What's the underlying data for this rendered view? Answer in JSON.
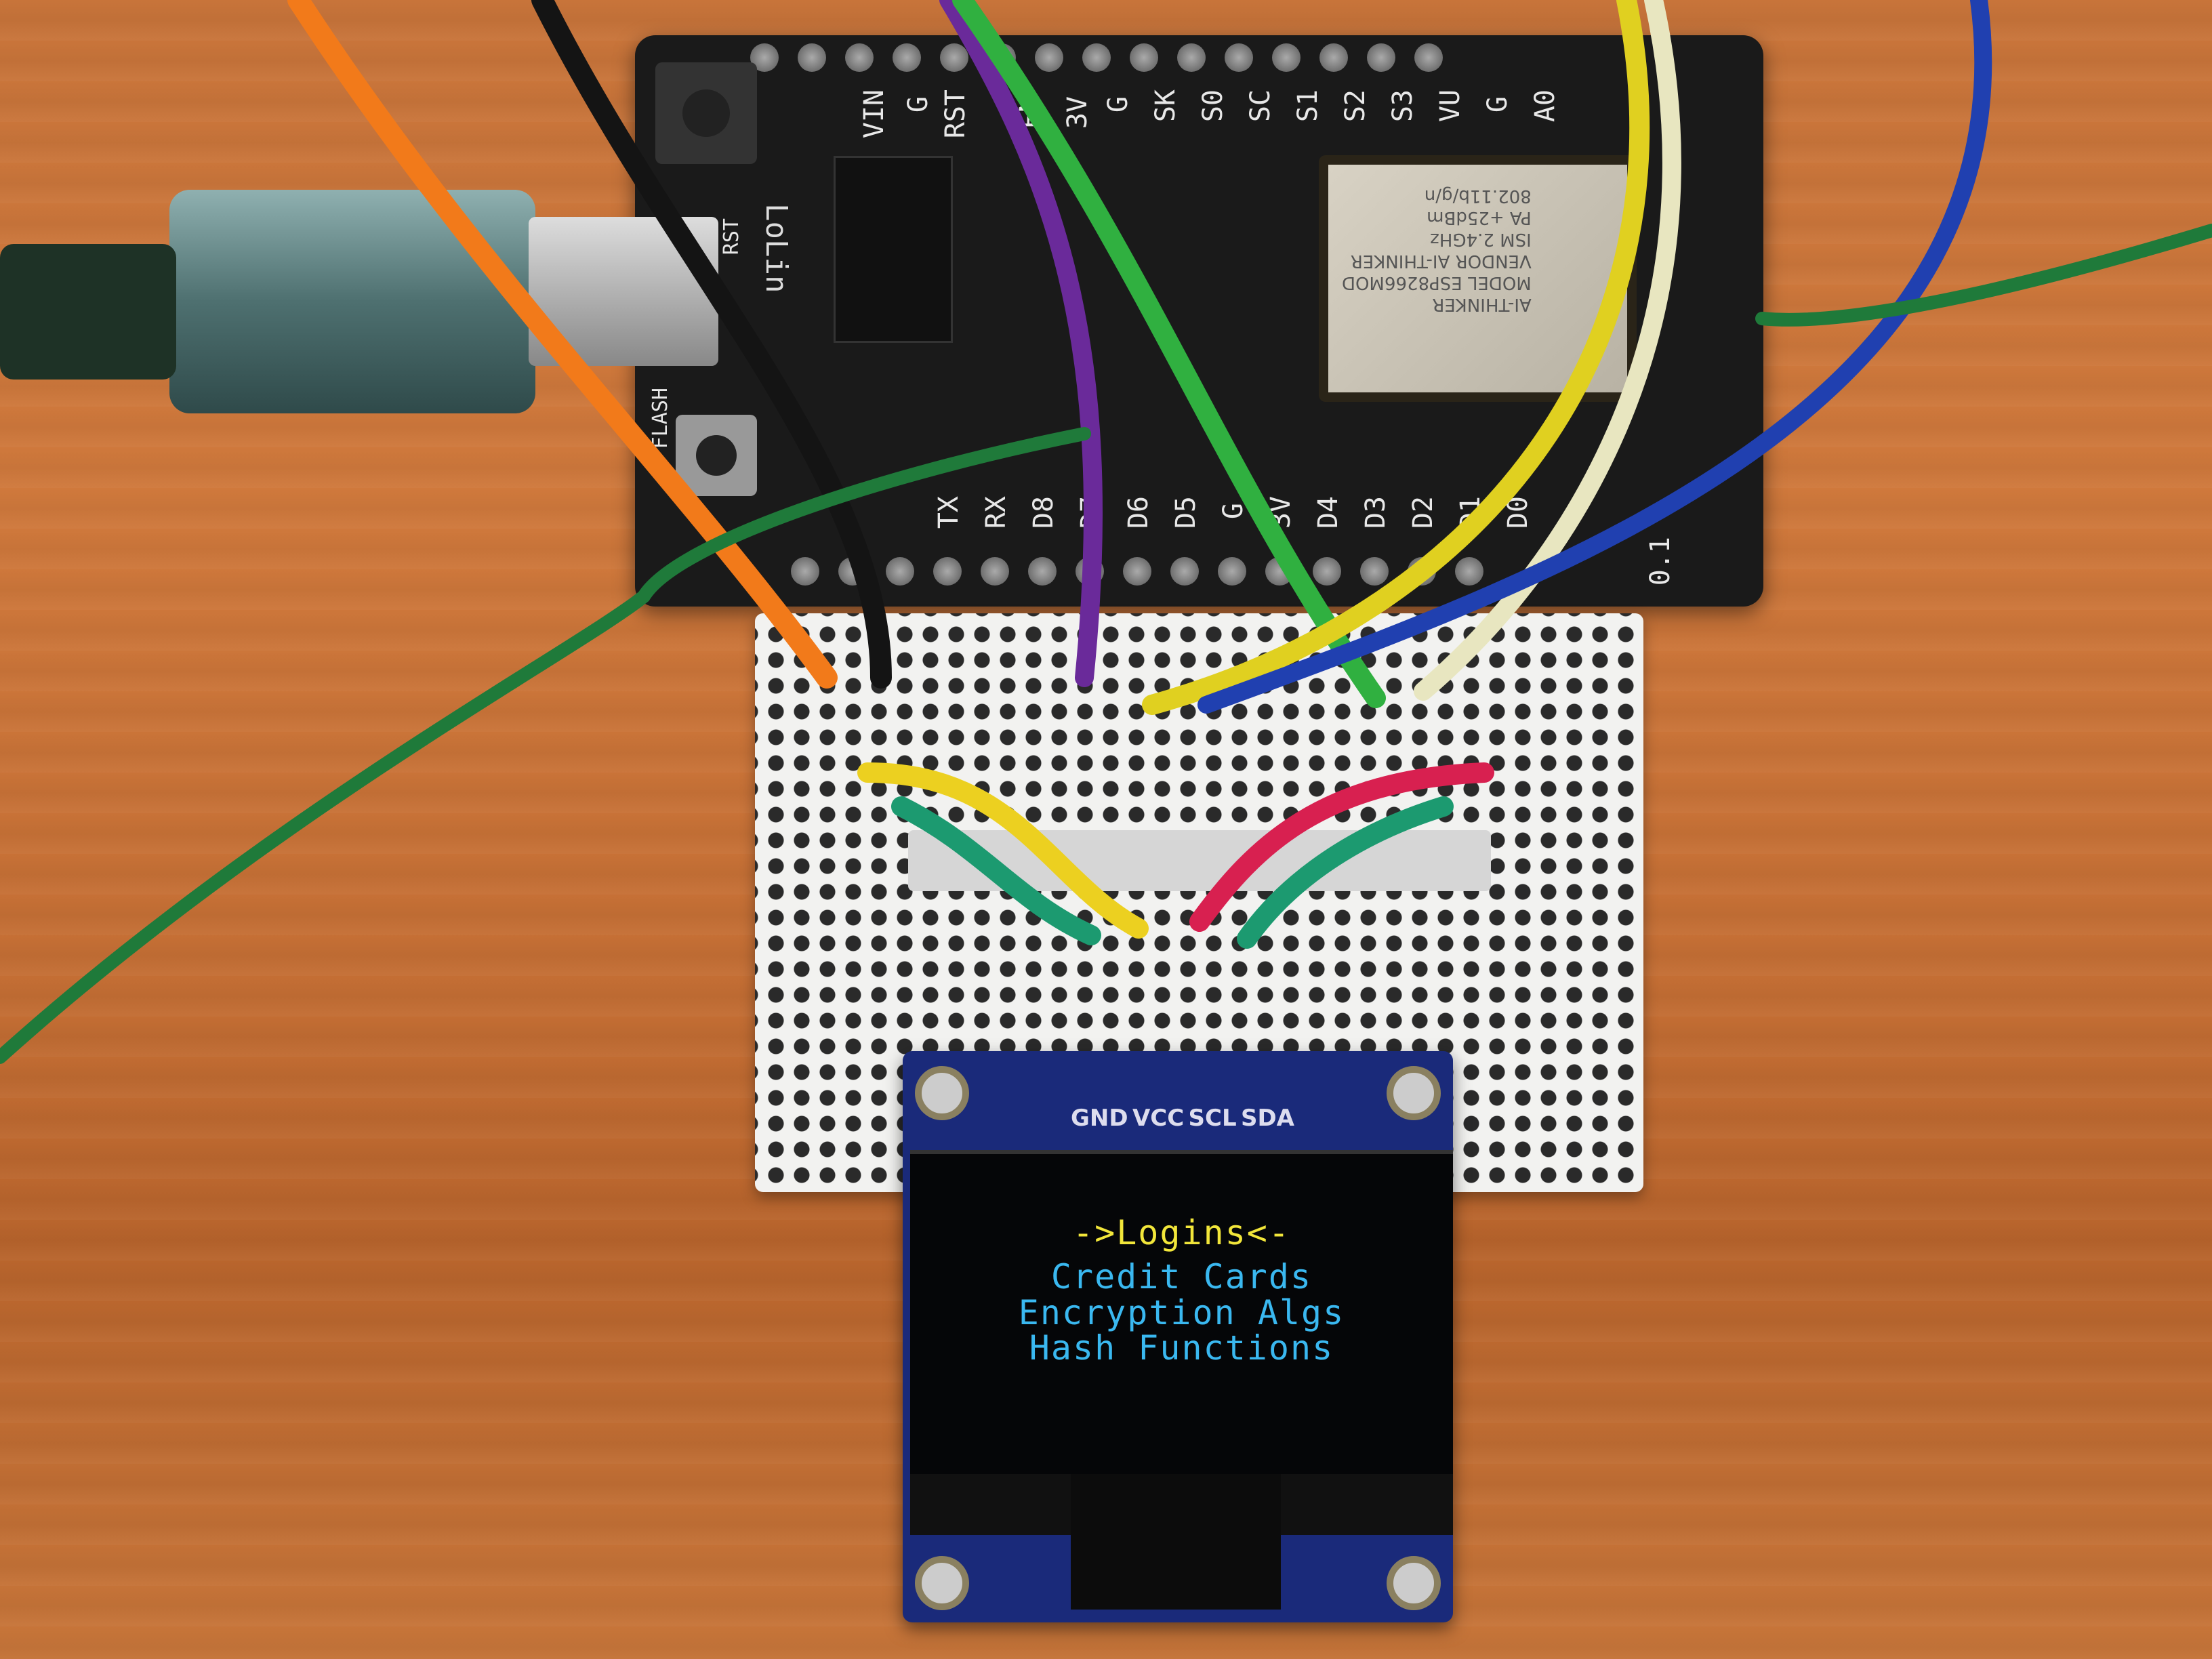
{
  "board": {
    "brand": "LoLin",
    "top_pins": [
      "VIN",
      "G",
      "RST",
      "EN",
      "3V",
      "G",
      "SK",
      "S0",
      "SC",
      "S1",
      "S2",
      "S3",
      "VU",
      "G",
      "A0"
    ],
    "bottom_pins": [
      "TX",
      "RX",
      "D8",
      "D7",
      "D6",
      "D5",
      "G",
      "3V",
      "D4",
      "D3",
      "D2",
      "D1",
      "D0"
    ],
    "buttons": [
      "RST",
      "FLASH"
    ],
    "version": "0.1",
    "module_text": [
      "AI-THINKER",
      "MODEL ESP8266MOD",
      "VENDOR AI-THINKER",
      "ISM 2.4GHz",
      "PA +25dBm",
      "802.11b/g/n"
    ]
  },
  "oled": {
    "pin_labels": [
      "GND",
      "VCC",
      "SCL",
      "SDA"
    ],
    "menu": {
      "selected": "->Logins<-",
      "items": [
        "Credit Cards",
        "Encryption Algs",
        "Hash Functions"
      ]
    },
    "colors": {
      "selected": "#f2e63a",
      "items": "#3ab8f0",
      "pcb": "#1a2a7a"
    }
  },
  "colors": {
    "table": "#c8743a",
    "board": "#1a1a1a",
    "breadboard": "#f2f2f0"
  }
}
